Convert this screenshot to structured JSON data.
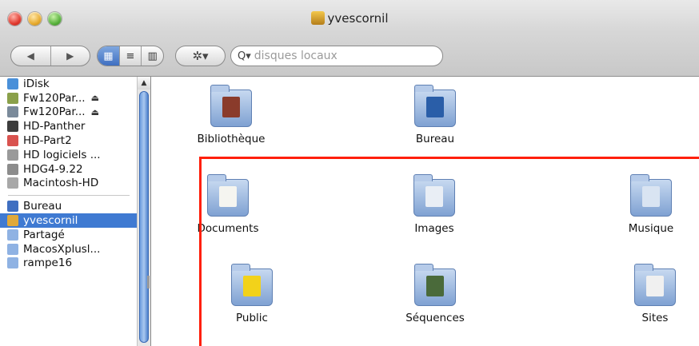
{
  "window": {
    "title": "yvescornil"
  },
  "toolbar": {
    "back_glyph": "◀",
    "forward_glyph": "▶",
    "view_icon": "▦",
    "view_list": "≡",
    "view_columns": "▥",
    "action_glyph": "✲▾",
    "search_glyph": "Q▾",
    "search_placeholder": "disques locaux"
  },
  "sidebar": {
    "devices": [
      {
        "label": "iDisk",
        "icon": "idisk-icon",
        "color": "#4a90d9",
        "eject": false
      },
      {
        "label": "Fw120Par...",
        "icon": "firewire-disk-icon",
        "color": "#8aa04a",
        "eject": true
      },
      {
        "label": "Fw120Par...",
        "icon": "firewire-disk-icon",
        "color": "#7a8a9a",
        "eject": true
      },
      {
        "label": "HD-Panther",
        "icon": "hd-panther-icon",
        "color": "#3d3d3d",
        "eject": false
      },
      {
        "label": "HD-Part2",
        "icon": "hd-part2-icon",
        "color": "#d9534f",
        "eject": false
      },
      {
        "label": "HD logiciels ...",
        "icon": "hard-disk-icon",
        "color": "#9a9a9a",
        "eject": false
      },
      {
        "label": "HDG4-9.22",
        "icon": "hard-disk-icon",
        "color": "#8c8c8c",
        "eject": false
      },
      {
        "label": "Macintosh-HD",
        "icon": "hard-disk-icon",
        "color": "#a8a8a8",
        "eject": false
      }
    ],
    "places": [
      {
        "label": "Bureau",
        "icon": "desktop-icon",
        "color": "#3f6fc1",
        "selected": false
      },
      {
        "label": "yvescornil",
        "icon": "home-icon",
        "color": "#e0a93a",
        "selected": true
      },
      {
        "label": "Partagé",
        "icon": "folder-icon",
        "color": "#8fb2e3",
        "selected": false
      },
      {
        "label": "MacosXplusl...",
        "icon": "folder-icon",
        "color": "#8fb2e3",
        "selected": false
      },
      {
        "label": "rampe16",
        "icon": "folder-icon",
        "color": "#8fb2e3",
        "selected": false
      }
    ],
    "eject_glyph": "⏏",
    "scroll_up_glyph": "▲"
  },
  "folders": [
    {
      "label": "Bibliothèque",
      "icon": "library-folder-icon",
      "badge": "#8a3b2b"
    },
    {
      "label": "Bureau",
      "icon": "desktop-folder-icon",
      "badge": "#2a5ea8"
    },
    {
      "label": "Documents",
      "icon": "documents-folder-icon",
      "badge": "#f5f5f0"
    },
    {
      "label": "Images",
      "icon": "images-folder-icon",
      "badge": "#e9eef5"
    },
    {
      "label": "Musique",
      "icon": "music-folder-icon",
      "badge": "#d9e4f2"
    },
    {
      "label": "Public",
      "icon": "public-folder-icon",
      "badge": "#f2d21a"
    },
    {
      "label": "Séquences",
      "icon": "movies-folder-icon",
      "badge": "#4a6a3a"
    },
    {
      "label": "Sites",
      "icon": "sites-folder-icon",
      "badge": "#f0f0f0"
    }
  ],
  "colors": {
    "selection": "#3f7ad2",
    "highlight": "#ff1f0a"
  }
}
